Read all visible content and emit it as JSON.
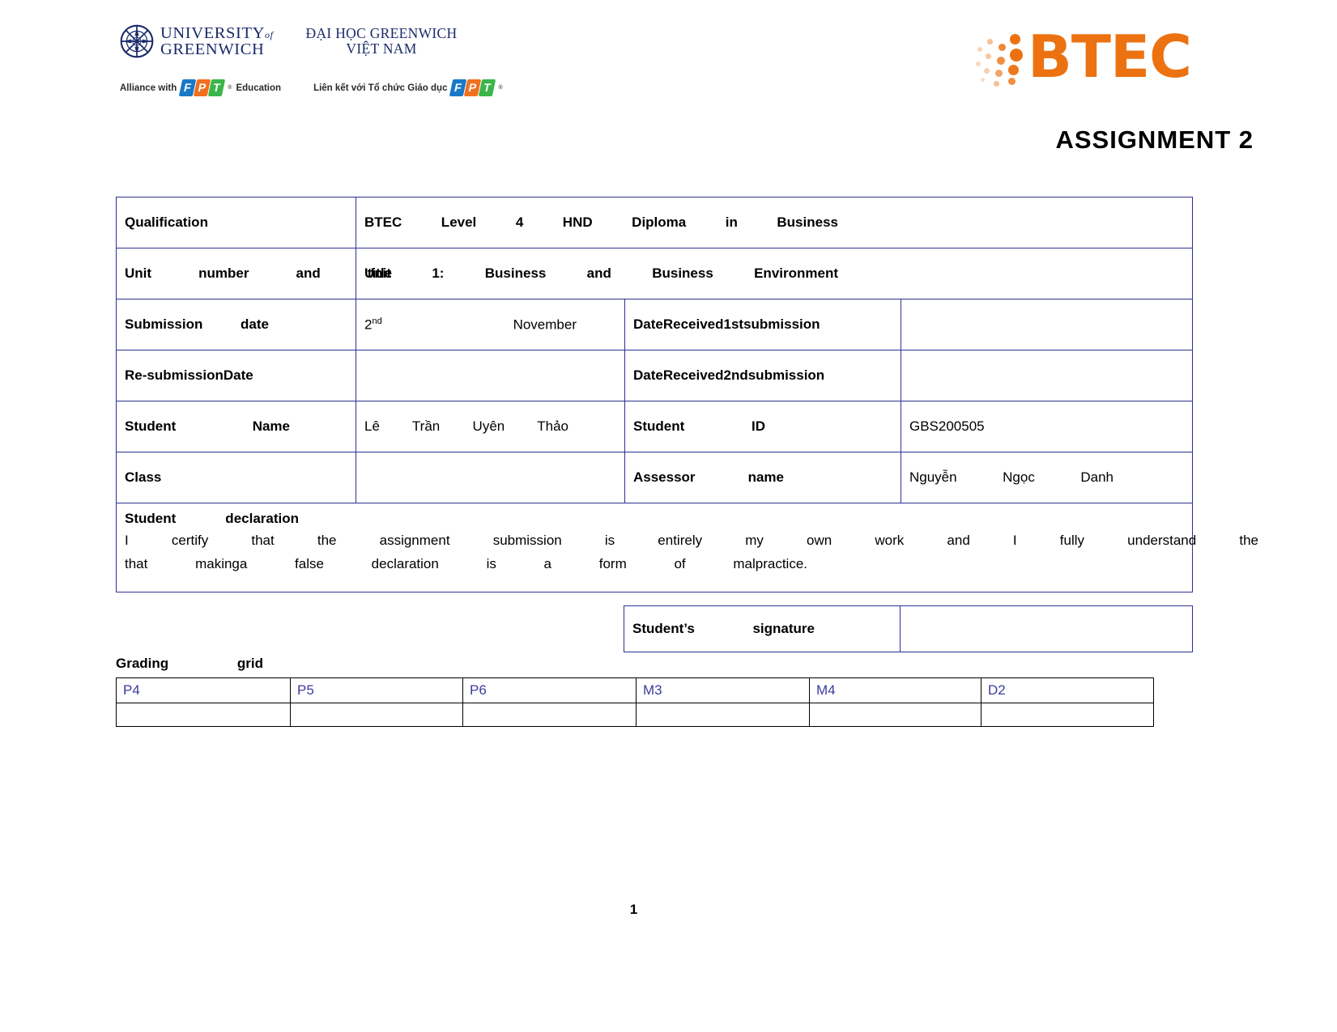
{
  "header": {
    "university_line1": "UNIVERSITY",
    "university_of": "of",
    "university_line2": "GREENWICH",
    "vn_line1": "ĐẠI HỌC GREENWICH",
    "vn_line2": "VIỆT NAM",
    "alliance_en": "Alliance with",
    "alliance_en_suffix": "Education",
    "alliance_vi": "Liên kết với Tổ chức Giáo dục",
    "fpt_letters": [
      "F",
      "P",
      "T"
    ],
    "btec_word": "BTEC",
    "brand_orange": "#ec7211",
    "brand_navy": "#1b2a6b",
    "table_border_blue": "#2e3192"
  },
  "title": "ASSIGNMENT 2",
  "form": {
    "qualification_label": "Qualification",
    "qualification_value": "BTEC Level 4 HND Diploma in Business",
    "unit_label": "Unit number and title",
    "unit_value": "Unit 1: Business and Business Environment",
    "submission_date_label": "Submission date",
    "submission_date_value_num": "2",
    "submission_date_value_ord": "nd",
    "submission_date_value_month": "November",
    "date_received_1st_label": "DateReceived1stsubmission",
    "date_received_1st_value": "",
    "resubmission_date_label": "Re-submissionDate",
    "resubmission_date_value": "",
    "date_received_2nd_label": "DateReceived2ndsubmission",
    "date_received_2nd_value": "",
    "student_name_label": "Student Name",
    "student_name_value": "Lê Trần Uyên Thảo",
    "student_id_label": "Student ID",
    "student_id_value": "GBS200505",
    "class_label": "Class",
    "class_value": "",
    "assessor_name_label": "Assessor name",
    "assessor_name_value": "Nguyễn Ngọc Danh",
    "declaration_title": "Student declaration",
    "declaration_line1": "I certify that the assignment submission is entirely my own work and I fully understand the",
    "declaration_line2": "that makinga false declaration is a form of malpractice.",
    "student_signature_label": "Student’s signature",
    "student_signature_value": ""
  },
  "grading": {
    "label": "Grading grid",
    "columns": [
      "P4",
      "P5",
      "P6",
      "M3",
      "M4",
      "D2"
    ],
    "values": [
      "",
      "",
      "",
      "",
      "",
      ""
    ],
    "text_color": "#3b3b9e"
  },
  "footer": {
    "page_number": "1"
  }
}
